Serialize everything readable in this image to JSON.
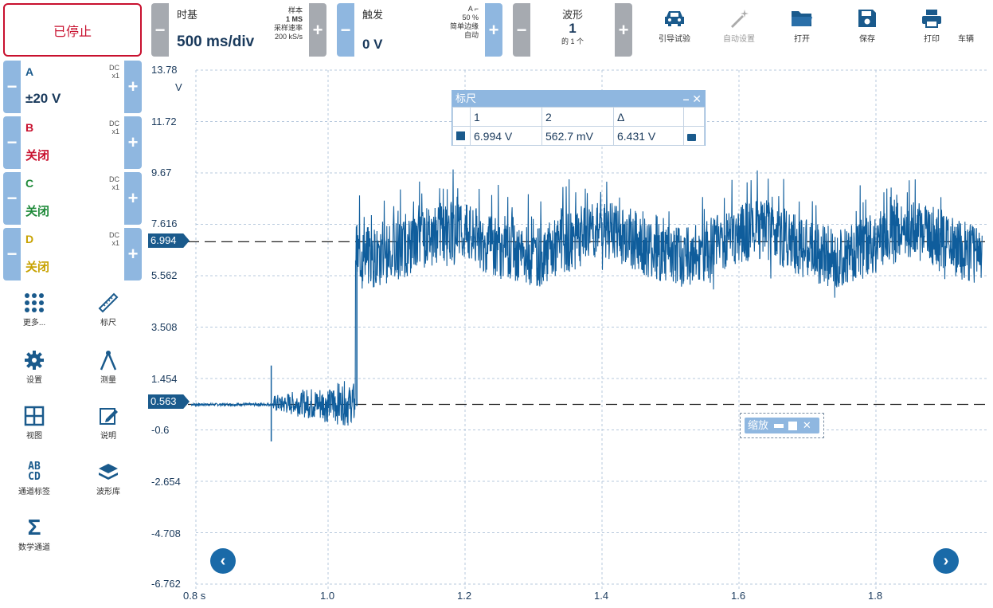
{
  "toolbar": {
    "stop_label": "已停止",
    "timebase": {
      "label": "时基",
      "value": "500 ms/div",
      "samples_label": "样本",
      "samples_value": "1 MS",
      "rate_label": "采样速率",
      "rate_value": "200 kS/s"
    },
    "trigger": {
      "label": "触发",
      "value": "0 V",
      "channel": "A",
      "percent": "50 %",
      "mode": "简单边缘",
      "auto": "自动"
    },
    "waveform": {
      "label": "波形",
      "value": "1",
      "of": "的 1 个"
    },
    "buttons": [
      {
        "label": "引导试验",
        "icon": "car-icon"
      },
      {
        "label": "自动设置",
        "icon": "magic-wand-icon"
      },
      {
        "label": "打开",
        "icon": "folder-icon"
      },
      {
        "label": "保存",
        "icon": "save-icon"
      },
      {
        "label": "打印",
        "icon": "print-icon"
      },
      {
        "label": "车辆",
        "icon": "vehicle-icon"
      }
    ]
  },
  "channels": [
    {
      "name": "A",
      "coupling": "DC",
      "probe": "x1",
      "range": "±20 V",
      "color": "#1a5a8c"
    },
    {
      "name": "B",
      "coupling": "DC",
      "probe": "x1",
      "range": "关闭",
      "color": "#c8102e"
    },
    {
      "name": "C",
      "coupling": "DC",
      "probe": "x1",
      "range": "关闭",
      "color": "#1f8a3a"
    },
    {
      "name": "D",
      "coupling": "DC",
      "probe": "x1",
      "range": "关闭",
      "color": "#c7a200"
    }
  ],
  "left_tools": [
    {
      "label": "更多...",
      "icon": "grid-dots-icon"
    },
    {
      "label": "标尺",
      "icon": "ruler-icon"
    },
    {
      "label": "设置",
      "icon": "gear-icon"
    },
    {
      "label": "测量",
      "icon": "compass-icon"
    },
    {
      "label": "视图",
      "icon": "view-grid-icon"
    },
    {
      "label": "说明",
      "icon": "note-edit-icon"
    },
    {
      "label": "通道标签",
      "icon": "abcd-icon"
    },
    {
      "label": "波形库",
      "icon": "waveform-library-icon"
    },
    {
      "label": "数学通道",
      "icon": "sigma-icon"
    }
  ],
  "plot": {
    "y_unit": "V",
    "x_unit": "s",
    "y_ticks": [
      "13.78",
      "11.72",
      "9.67",
      "7.616",
      "5.562",
      "3.508",
      "1.454",
      "-0.6",
      "-2.654",
      "-4.708",
      "-6.762"
    ],
    "x_ticks": [
      "0.8",
      "1.0",
      "1.2",
      "1.4",
      "1.6",
      "1.8"
    ],
    "ruler1_value": "6.994",
    "ruler2_value": "0.563",
    "trace_color": "#0f5d9c"
  },
  "ruler_window": {
    "title": "标尺",
    "headers": [
      "1",
      "2",
      "Δ"
    ],
    "values": [
      "6.994 V",
      "562.7 mV",
      "6.431 V"
    ]
  },
  "zoom": {
    "label": "缩放"
  }
}
